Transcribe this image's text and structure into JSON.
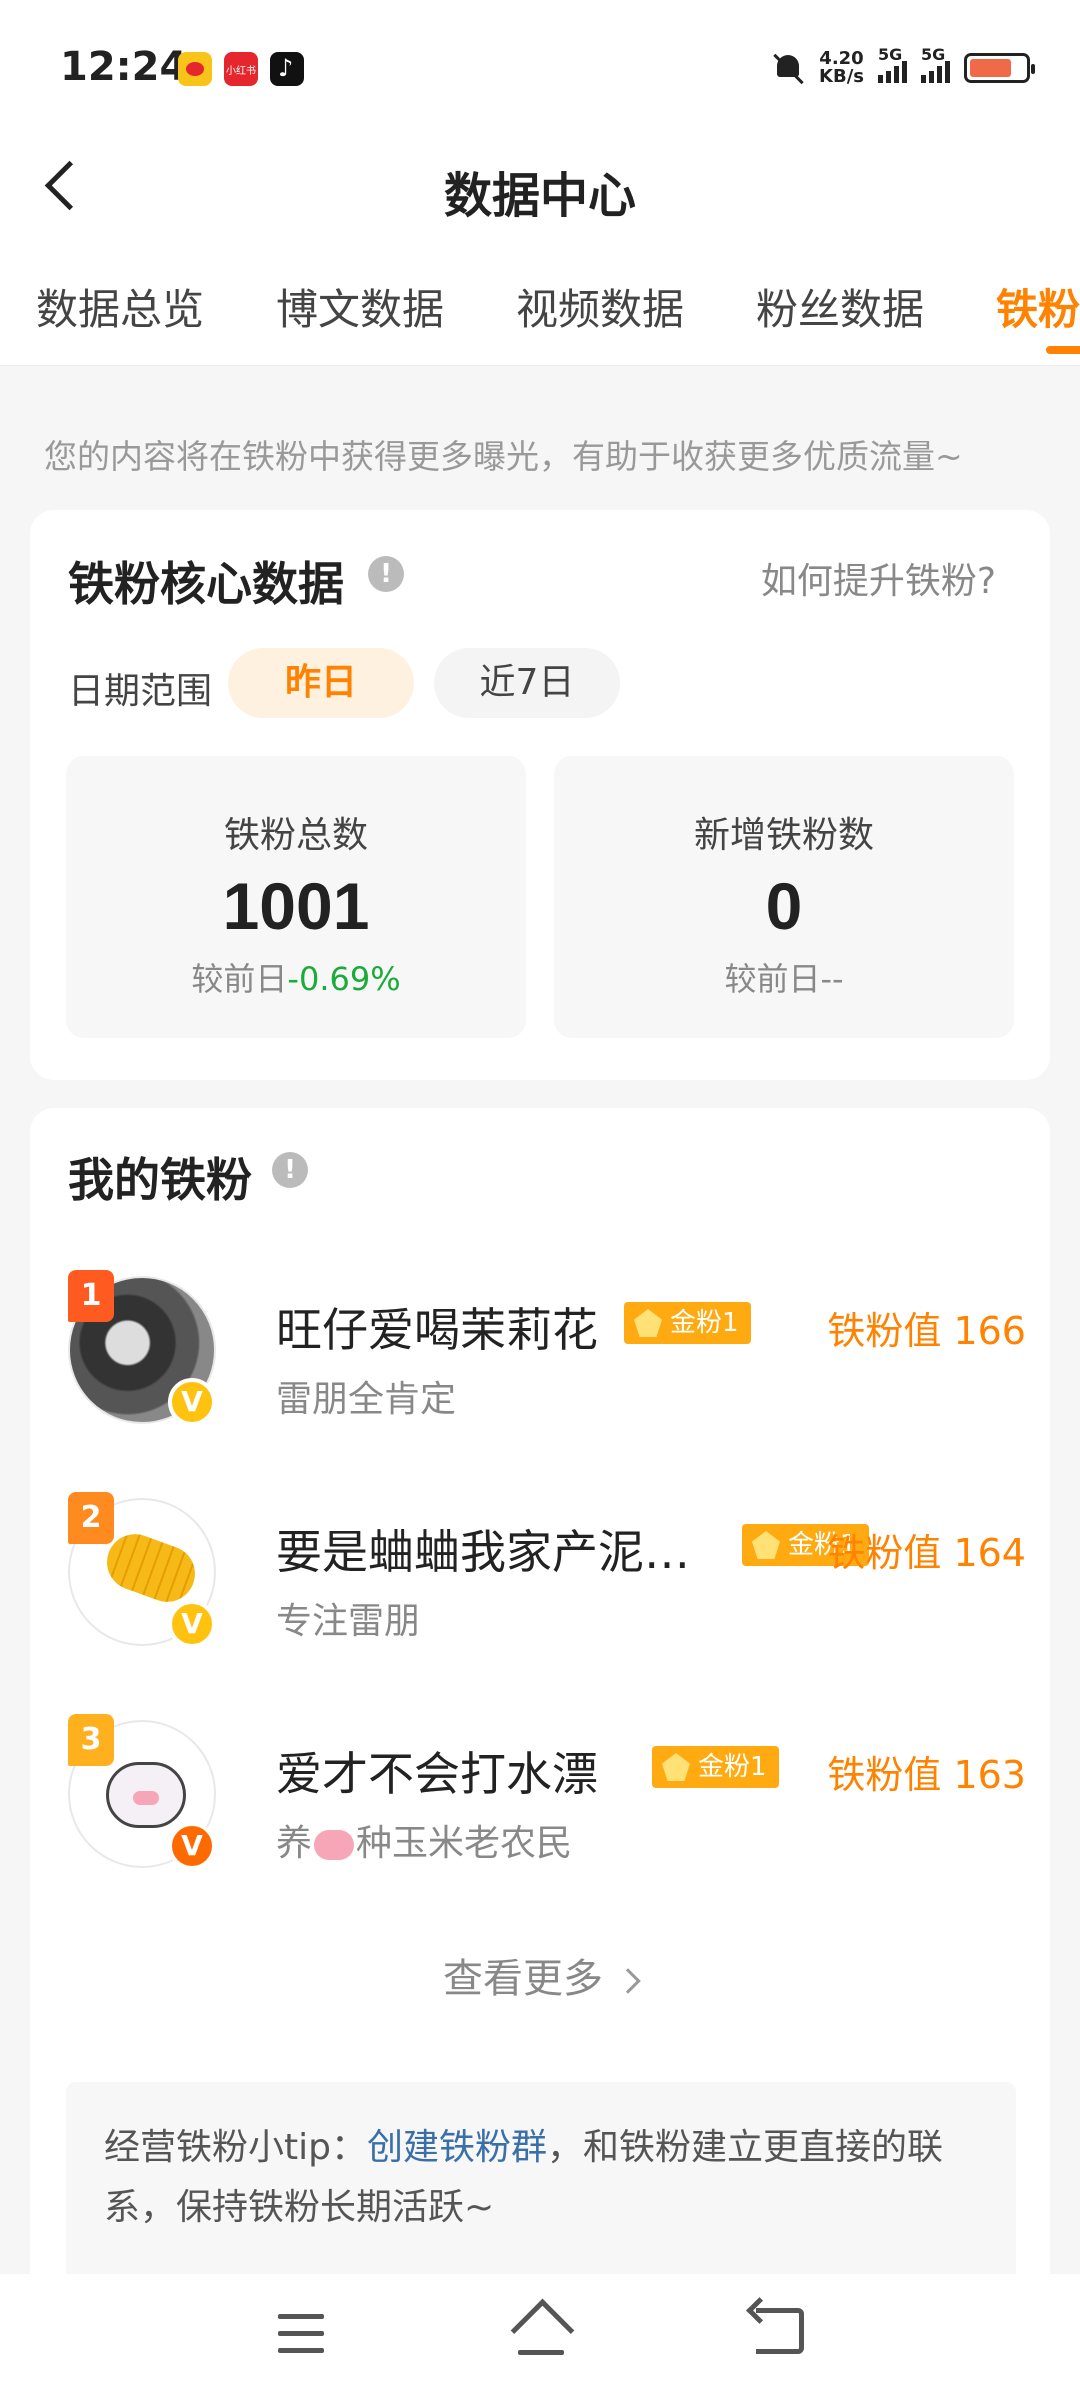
{
  "status_bar": {
    "time": "12:24",
    "network_speed_value": "4.20",
    "network_speed_unit": "KB/s",
    "signal_1": "5G",
    "signal_2": "5G",
    "battery_level": 0.75,
    "apps": [
      "weibo-icon",
      "xiaohongshu-icon",
      "tiktok-icon"
    ],
    "xiaohongshu_text": "小红书"
  },
  "header": {
    "title": "数据中心"
  },
  "tabs": [
    "数据总览",
    "博文数据",
    "视频数据",
    "粉丝数据",
    "铁粉"
  ],
  "active_tab_index": 4,
  "notice": "您的内容将在铁粉中获得更多曝光，有助于收获更多优质流量~",
  "core": {
    "title": "铁粉核心数据",
    "help_link": "如何提升铁粉?",
    "date_range_label": "日期范围",
    "date_options": [
      "昨日",
      "近7日"
    ],
    "selected_date": "昨日",
    "stats": [
      {
        "label": "铁粉总数",
        "value": "1001",
        "compare_label": "较前日",
        "compare_value": "-0.69%"
      },
      {
        "label": "新增铁粉数",
        "value": "0",
        "compare_label": "较前日",
        "compare_value": "--"
      }
    ]
  },
  "my_fans": {
    "title": "我的铁粉",
    "items": [
      {
        "rank": "1",
        "name": "旺仔爱喝茉莉花",
        "badge": "金粉1",
        "desc_before": "雷朋全肯定",
        "desc_after": "",
        "score": "铁粉值 166"
      },
      {
        "rank": "2",
        "name": "要是蛐蛐我家产泥…",
        "badge": "金粉1",
        "desc_before": "专注雷朋",
        "desc_after": "",
        "score": "铁粉值 164"
      },
      {
        "rank": "3",
        "name": "爱才不会打水漂",
        "badge": "金粉1",
        "desc_before": "养",
        "desc_after": "种玉米老农民",
        "score": "铁粉值 163"
      }
    ],
    "see_more": "查看更多",
    "tip_prefix": "经营铁粉小tip：",
    "tip_link": "创建铁粉群",
    "tip_suffix": "，和铁粉建立更直接的联系，保持铁粉长期活跃~"
  },
  "colors": {
    "accent": "#ff8200",
    "positive": "#1aab3b",
    "link": "#3a6fa8"
  }
}
